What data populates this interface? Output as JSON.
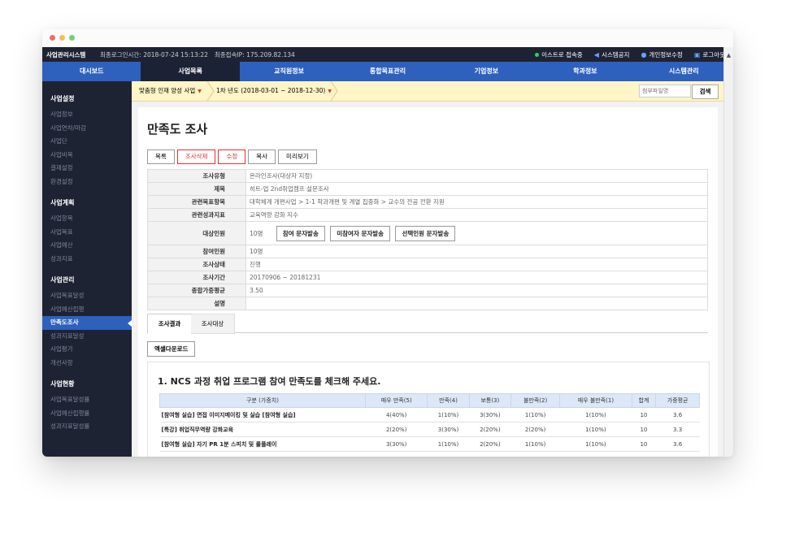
{
  "topbar": {
    "system_name": "사업관리시스템",
    "last_login": "최종로그인시간: 2018-07-24 15:13:22",
    "last_ip": "최종접속IP: 175.209.82.134",
    "status": "이스트로 접속중",
    "notice": "시스템공지",
    "profile": "개인정보수정",
    "logout": "로그아웃"
  },
  "nav": [
    "대시보드",
    "사업목록",
    "교직원정보",
    "통합목표관리",
    "기업정보",
    "학과정보",
    "시스템관리"
  ],
  "sidebar": {
    "sections": [
      {
        "title": "사업설정",
        "items": [
          "사업정보",
          "사업연차/마감",
          "사업단",
          "사업비목",
          "결재설정",
          "환경설정"
        ]
      },
      {
        "title": "사업계획",
        "items": [
          "사업항목",
          "사업목표",
          "사업예산",
          "성과지표"
        ]
      },
      {
        "title": "사업관리",
        "items": [
          "사업목표달성",
          "사업예산집행",
          "만족도조사",
          "성과지표달성",
          "사업평가",
          "개선사항"
        ]
      },
      {
        "title": "사업현황",
        "items": [
          "사업목표달성률",
          "사업예산집행률",
          "성과지표달성률"
        ]
      }
    ]
  },
  "breadcrumb": {
    "project": "맞춤형 인재 양성 사업",
    "year": "1차 년도 (2018-03-01 ~ 2018-12-30)",
    "search_placeholder": "첨부파일명",
    "search_button": "검색"
  },
  "page": {
    "title": "만족도 조사",
    "buttons": [
      "목록",
      "조사삭제",
      "수정",
      "복사",
      "미리보기"
    ]
  },
  "info": {
    "type_label": "조사유형",
    "type": "온라인조사(대상자 지정)",
    "title_label": "제목",
    "title": "히트-업 2nd취업캠프 설문조사",
    "target_label": "관련목표항목",
    "target": "대학체계 개편사업 > 1-1 학과개편 및 계열 집중화 > 교수의 전공 전환 지원",
    "indicator_label": "관련성과지표",
    "indicator": "교육역량 강화 지수",
    "audience_label": "대상인원",
    "audience": "10명",
    "sms_buttons": [
      "참여 문자발송",
      "미참여자 문자발송",
      "선택인원 문자발송"
    ],
    "participants_label": "참여인원",
    "participants": "10명",
    "status_label": "조사상태",
    "status": "진행",
    "period_label": "조사기간",
    "period": "20170906 ~ 20181231",
    "avg_label": "종합가중평균",
    "avg": "3.50",
    "desc_label": "설명",
    "desc": ""
  },
  "tabs": [
    "조사결과",
    "조사대상"
  ],
  "excel_button": "엑셀다운로드",
  "question": {
    "title": "1. NCS 과정 취업 프로그램 참여 만족도를 체크해 주세요.",
    "headers": [
      "구분 (가중치)",
      "매우 만족(5)",
      "만족(4)",
      "보통(3)",
      "불만족(2)",
      "매우 불만족(1)",
      "합계",
      "가중평균"
    ],
    "rows": [
      [
        "[참여형 실습] 면접 이미지메이킹 및 실습 [참여형 실습]",
        "4(40%)",
        "1(10%)",
        "3(30%)",
        "1(10%)",
        "1(10%)",
        "10",
        "3.6"
      ],
      [
        "[특강] 취업직무역량 강화교육",
        "2(20%)",
        "3(30%)",
        "2(20%)",
        "2(20%)",
        "1(10%)",
        "10",
        "3.3"
      ],
      [
        "[참여형 실습] 자기 PR 1분 스피치 및 롤플레이",
        "3(30%)",
        "1(10%)",
        "2(20%)",
        "1(10%)",
        "1(10%)",
        "10",
        "3.6"
      ]
    ]
  }
}
